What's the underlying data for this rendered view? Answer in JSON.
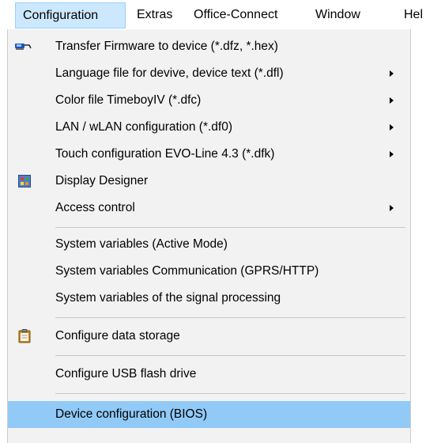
{
  "menubar": {
    "items": [
      {
        "label": "Configuration",
        "active": true
      },
      {
        "label": "Extras"
      },
      {
        "label": "Office-Connect"
      },
      {
        "label": "Window"
      },
      {
        "label": "Hel"
      }
    ]
  },
  "dropdown": {
    "items": [
      {
        "label": "Transfer Firmware to device (*.dfz, *.hex)",
        "icon": "transfer-device-icon",
        "submenu": false
      },
      {
        "label": "Language file for devive, device text (*.dfl)",
        "submenu": true
      },
      {
        "label": "Color file TimeboyIV (*.dfc)",
        "submenu": true
      },
      {
        "label": "LAN / wLAN configuration (*.df0)",
        "submenu": true
      },
      {
        "label": "Touch configuration EVO-Line 4.3 (*.dfk)",
        "submenu": true
      },
      {
        "label": "Display Designer",
        "icon": "display-designer-icon",
        "submenu": false
      },
      {
        "label": "Access control",
        "submenu": true
      },
      {
        "label": "System variables (Active Mode)",
        "submenu": false
      },
      {
        "label": "System variables Communication (GPRS/HTTP)",
        "submenu": false
      },
      {
        "label": "System variables of the signal processing",
        "submenu": false
      },
      {
        "label": "Configure data storage",
        "icon": "clipboard-icon",
        "submenu": false
      },
      {
        "label": "Configure USB flash drive",
        "submenu": false
      },
      {
        "label": "Device configuration (BIOS)",
        "submenu": false,
        "highlighted": true
      }
    ]
  },
  "colors": {
    "menubar_active_bg": "#cce8ff",
    "menu_bg": "#f2f2f2",
    "highlight_bg": "#91c9f7"
  }
}
